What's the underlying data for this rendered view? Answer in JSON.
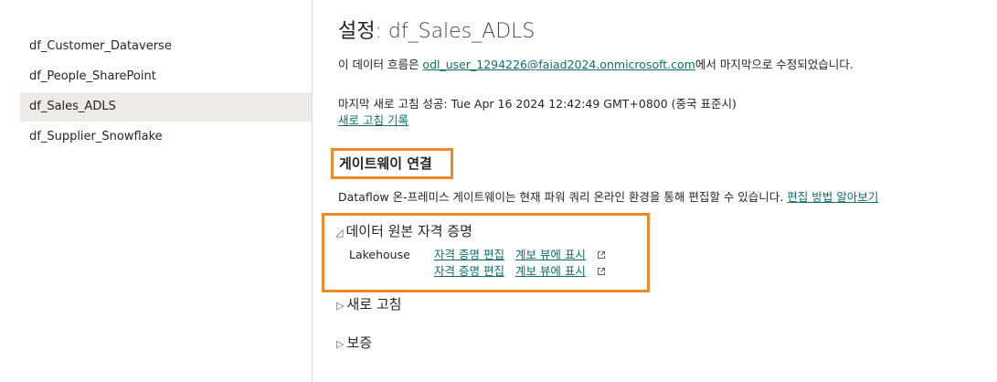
{
  "sidebar": {
    "items": [
      {
        "label": "df_Customer_Dataverse",
        "active": false
      },
      {
        "label": "df_People_SharePoint",
        "active": false
      },
      {
        "label": "df_Sales_ADLS",
        "active": true
      },
      {
        "label": "df_Supplier_Snowflake",
        "active": false
      }
    ]
  },
  "header": {
    "title_label": "설정",
    "title_name": ": df_Sales_ADLS"
  },
  "info": {
    "modified_prefix": "이 데이터 흐름은 ",
    "modified_user": "odl_user_1294226@faiad2024.onmicrosoft.com",
    "modified_suffix": "에서 마지막으로 수정되었습니다.",
    "last_refresh": "마지막 새로 고침 성공: Tue Apr 16 2024 12:42:49 GMT+0800 (중국 표준시)",
    "refresh_history_link": "새로 고침 기록"
  },
  "gateway": {
    "heading": "게이트웨이 연결",
    "description": "Dataflow 온-프레미스 게이트웨이는 현재 파워 쿼리 온라인 환경을 통해 편집할 수 있습니다.",
    "learn_link": "편집 방법 알아보기"
  },
  "datasource": {
    "heading": "데이터 원본 자격 증명",
    "caret": "◿",
    "source_name": "Lakehouse",
    "rows": [
      {
        "edit_label": "자격 증명 편집",
        "view_label": "계보 뷰에 표시"
      },
      {
        "edit_label": "자격 증명 편집",
        "view_label": "계보 뷰에 표시"
      }
    ]
  },
  "refresh_section": {
    "caret": "▷",
    "label": "새로 고침"
  },
  "endorsement_section": {
    "caret": "▷",
    "label": "보증"
  },
  "colors": {
    "highlight_border": "#f08a24",
    "link": "#0f6e6a",
    "sidebar_active_bg": "#edebe9"
  }
}
